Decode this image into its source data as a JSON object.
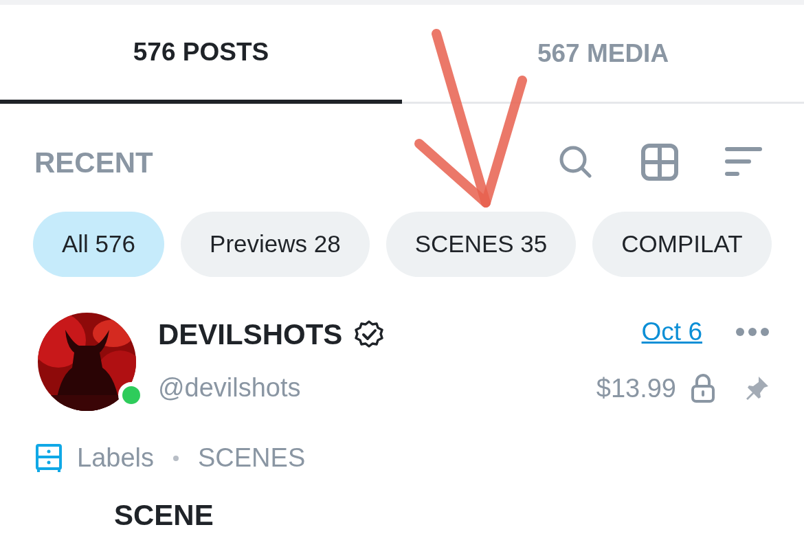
{
  "tabs": [
    {
      "label": "576 POSTS",
      "selected": true
    },
    {
      "label": "567 MEDIA",
      "selected": false
    }
  ],
  "section": {
    "title": "RECENT"
  },
  "filters": [
    {
      "label": "All 576",
      "selected": true
    },
    {
      "label": "Previews 28",
      "selected": false
    },
    {
      "label": "SCENES 35",
      "selected": false
    },
    {
      "label": "COMPILAT",
      "selected": false
    }
  ],
  "post": {
    "author": "DEVILSHOTS",
    "verified": true,
    "handle": "@devilshots",
    "online": true,
    "date": "Oct 6",
    "price": "$13.99",
    "locked": true,
    "pinned": true,
    "labels": {
      "title": "Labels",
      "items": [
        "SCENES"
      ]
    },
    "text": "SCENE"
  },
  "annotation": {
    "kind": "arrow"
  }
}
